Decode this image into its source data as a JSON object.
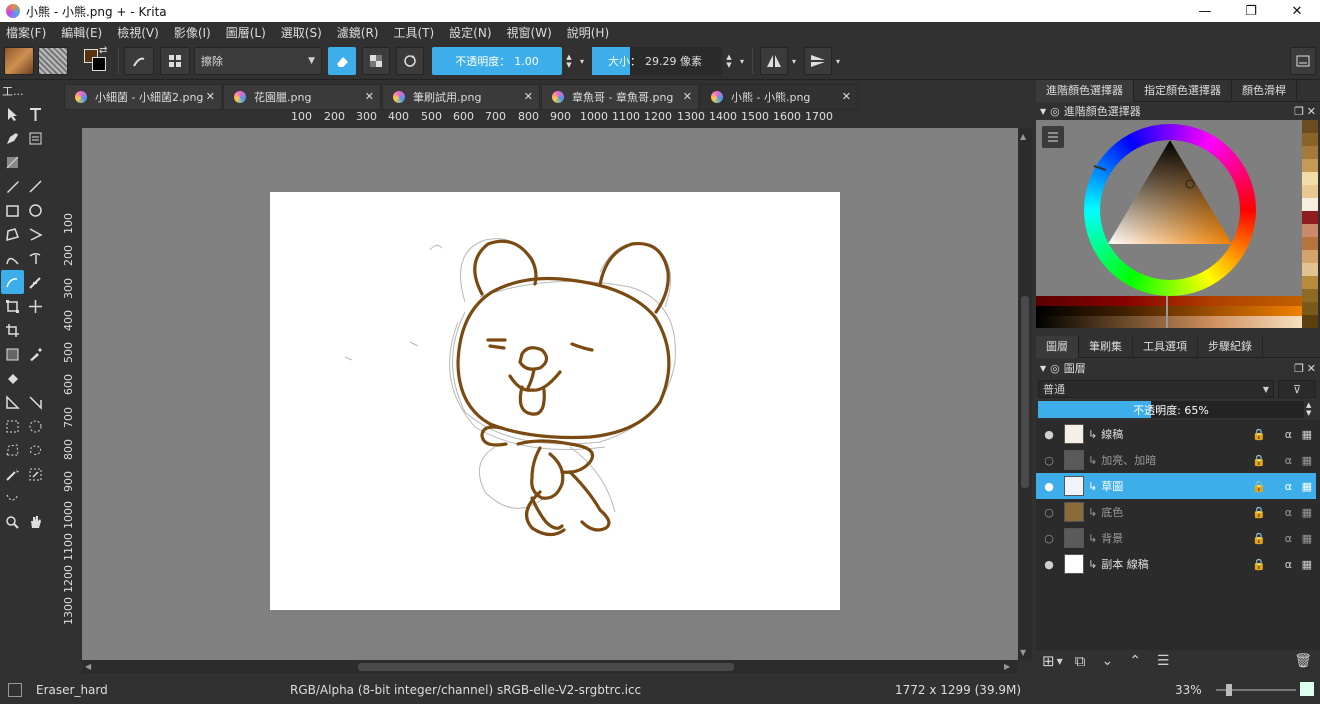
{
  "window": {
    "title": "小熊 - 小熊.png + - Krita",
    "minimize": "—",
    "maximize": "❐",
    "close": "✕"
  },
  "menu": [
    "檔案(F)",
    "編輯(E)",
    "檢視(V)",
    "影像(I)",
    "圖層(L)",
    "選取(S)",
    "濾鏡(R)",
    "工具(T)",
    "設定(N)",
    "視窗(W)",
    "說明(H)"
  ],
  "toolbar": {
    "blend_mode": "擦除",
    "opacity_label": "不透明度：",
    "opacity_value": "1.00",
    "size_label": "大小：",
    "size_value": "29.29 像素"
  },
  "toolbox": {
    "title": "工..."
  },
  "tabs": [
    {
      "label": "小細菌 - 小細菌2.png"
    },
    {
      "label": "花園臘.png"
    },
    {
      "label": "筆刷試用.png"
    },
    {
      "label": "章魚哥 - 章魚哥.png"
    },
    {
      "label": "小熊 - 小熊.png"
    }
  ],
  "rulers": {
    "horizontal": [
      "100",
      "200",
      "300",
      "400",
      "500",
      "600",
      "700",
      "800",
      "900",
      "1000",
      "1100",
      "1200",
      "1300",
      "1400",
      "1500",
      "1600",
      "1700"
    ],
    "vertical": [
      "100",
      "200",
      "300",
      "400",
      "500",
      "600",
      "700",
      "800",
      "900",
      "1000",
      "1100",
      "1200",
      "1300"
    ]
  },
  "right_panel": {
    "top_tabs": [
      "進階顏色選擇器",
      "指定顏色選擇器",
      "顏色滑桿"
    ],
    "color_docker_title": "進階顏色選擇器",
    "palette_colors": [
      "#6b4c1e",
      "#8a6427",
      "#a47a3a",
      "#c49a54",
      "#f2dcaa",
      "#e8c98f",
      "#f6efe0",
      "#8f1d1d",
      "#c9896a",
      "#b9733d",
      "#d4a46b",
      "#e2c290",
      "#b88a3c",
      "#8f6a22",
      "#7a5a1a",
      "#5c3f0e"
    ],
    "bottom_tabs": [
      "圖層",
      "筆刷集",
      "工具選項",
      "步驟紀錄"
    ],
    "layers_title": "圖層",
    "blend": "普通",
    "opacity_text": "不透明度: 65%",
    "opacity_fraction": 0.65,
    "layers": [
      {
        "name": "線稿",
        "visible": true,
        "selected": false,
        "thumb": "#f5efe5"
      },
      {
        "name": "加亮、加暗",
        "visible": false,
        "selected": false,
        "thumb": "#5a5a5a"
      },
      {
        "name": "草圖",
        "visible": true,
        "selected": true,
        "thumb": "#eef4fa"
      },
      {
        "name": "底色",
        "visible": false,
        "selected": false,
        "thumb": "#8b6b3c"
      },
      {
        "name": "背景",
        "visible": false,
        "selected": false,
        "thumb": "#5a5a5a"
      },
      {
        "name": "副本 線稿",
        "visible": true,
        "selected": false,
        "thumb": "#ffffff"
      }
    ]
  },
  "status": {
    "brush": "Eraser_hard",
    "color_space": "RGB/Alpha (8-bit integer/channel)  sRGB-elle-V2-srgbtrc.icc",
    "dimensions": "1772 x 1299 (39.9M)",
    "zoom": "33%"
  },
  "colors": {
    "accent": "#3daee9",
    "bg": "#313131",
    "canvas_bg": "#808080",
    "lineart": "#7a4a12"
  }
}
